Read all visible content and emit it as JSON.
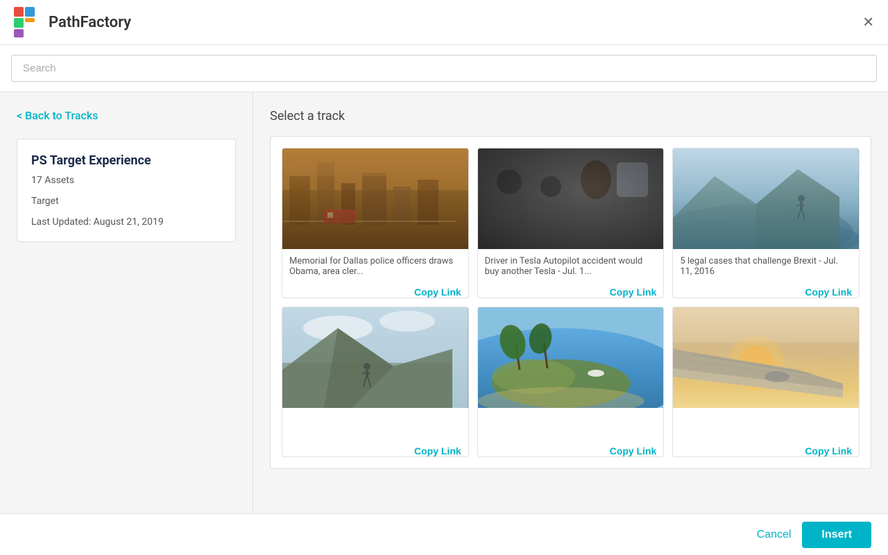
{
  "header": {
    "logo_text": "PathFactory",
    "close_label": "✕"
  },
  "search": {
    "placeholder": "Search"
  },
  "sidebar": {
    "back_link": "< Back to Tracks",
    "track": {
      "title": "PS Target Experience",
      "assets": "17 Assets",
      "target": "Target",
      "last_updated": "Last Updated: August 21, 2019"
    }
  },
  "content": {
    "heading": "Select a track",
    "items": [
      {
        "id": "item-1",
        "title": "Memorial for Dallas police officers draws Obama, area cler...",
        "copy_link": "Copy Link",
        "img_type": "city"
      },
      {
        "id": "item-2",
        "title": "Driver in Tesla Autopilot accident would buy another Tesla - Jul. 1...",
        "copy_link": "Copy Link",
        "img_type": "tesla"
      },
      {
        "id": "item-3",
        "title": "5 legal cases that challenge Brexit - Jul. 11, 2016",
        "copy_link": "Copy Link",
        "img_type": "brexit"
      },
      {
        "id": "item-4",
        "title": "",
        "copy_link": "Copy Link",
        "img_type": "mountain1"
      },
      {
        "id": "item-5",
        "title": "",
        "copy_link": "Copy Link",
        "img_type": "beach"
      },
      {
        "id": "item-6",
        "title": "",
        "copy_link": "Copy Link",
        "img_type": "plane"
      }
    ]
  },
  "footer": {
    "cancel_label": "Cancel",
    "insert_label": "Insert"
  }
}
